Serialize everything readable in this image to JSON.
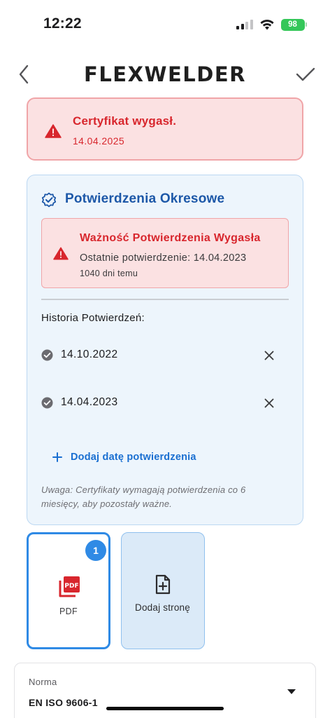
{
  "status_bar": {
    "time": "12:22",
    "battery_level": "98",
    "signal_bars_active": 2,
    "signal_bars_total": 4
  },
  "nav": {
    "back_icon": "chevron-left-icon",
    "title": "FLEXWELDER",
    "confirm_icon": "checkmark-icon"
  },
  "certificate_alert": {
    "title": "Certyfikat wygasł.",
    "date": "14.04.2025",
    "icon": "warning-triangle-icon",
    "color": "#d8262d"
  },
  "periodic": {
    "title": "Potwierdzenia Okresowe",
    "icon": "verified-badge-icon",
    "accent": "#1d58a8",
    "validity": {
      "title": "Ważność Potwierdzenia Wygasła",
      "last_confirmation": "Ostatnie potwierdzenie: 14.04.2023",
      "days_ago": "1040 dni temu"
    },
    "history_label": "Historia Potwierdzeń:",
    "history": [
      {
        "date": "14.10.2022"
      },
      {
        "date": "14.04.2023"
      }
    ],
    "add_label": "Dodaj datę potwierdzenia",
    "note": "Uwaga: Certyfikaty wymagają potwierdzenia co 6 miesięcy, aby pozostały ważne."
  },
  "pages": {
    "pdf_tile": {
      "label": "PDF",
      "badge": "1",
      "icon": "pdf-file-icon"
    },
    "add_tile": {
      "label": "Dodaj stronę",
      "icon": "add-page-icon"
    }
  },
  "norma": {
    "label": "Norma",
    "value": "EN ISO 9606-1"
  }
}
